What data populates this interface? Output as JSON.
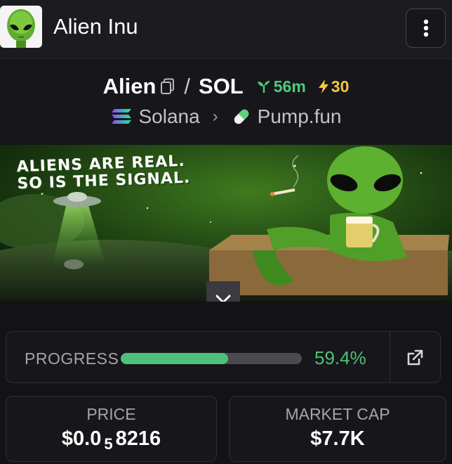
{
  "header": {
    "title": "Alien Inu",
    "logo_icon": "alien-head-icon",
    "menu_icon": "vertical-dots-icon"
  },
  "token": {
    "base": "Alien",
    "separator": "/",
    "quote": "SOL",
    "age": "56m",
    "boosts": "30",
    "chain": "Solana",
    "dex": "Pump.fun"
  },
  "banner": {
    "line1": "ALIENS ARE REAL.",
    "line2": "SO IS THE SIGNAL."
  },
  "progress": {
    "label": "PROGRESS",
    "value": "59.4%",
    "fraction": 0.594
  },
  "price": {
    "label": "PRICE",
    "prefix": "$0.0",
    "zeros": "5",
    "digits": "8216"
  },
  "market_cap": {
    "label": "MARKET CAP",
    "value": "$7.7K"
  },
  "colors": {
    "accent_green": "#4ec07a",
    "boost_yellow": "#f2c545",
    "background": "#131316"
  }
}
